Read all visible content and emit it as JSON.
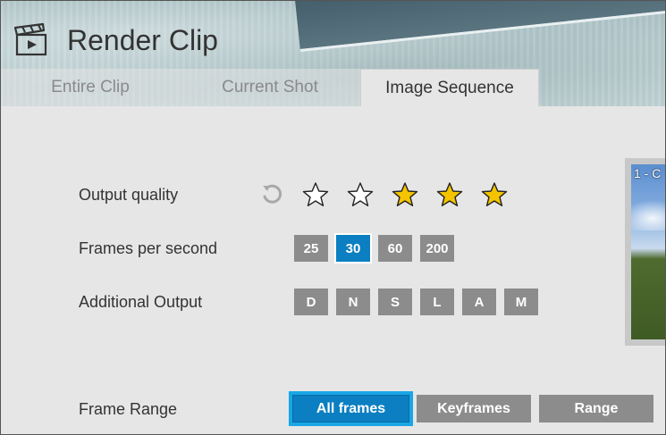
{
  "window": {
    "title": "Render Clip"
  },
  "tabs": [
    {
      "label": "Entire Clip",
      "active": false
    },
    {
      "label": "Current Shot",
      "active": false
    },
    {
      "label": "Image Sequence",
      "active": true
    }
  ],
  "output_quality": {
    "label": "Output quality",
    "reset_icon": "reset-icon",
    "stars_total": 5,
    "stars_filled": 3,
    "filled_color": "#f5c400",
    "empty_color": "#ffffff"
  },
  "fps": {
    "label": "Frames per second",
    "options": [
      "25",
      "30",
      "60",
      "200"
    ],
    "selected": "30"
  },
  "additional_output": {
    "label": "Additional Output",
    "options": [
      "D",
      "N",
      "S",
      "L",
      "A",
      "M"
    ]
  },
  "frame_range": {
    "label": "Frame Range",
    "options": [
      "All frames",
      "Keyframes",
      "Range"
    ],
    "selected": "All frames"
  },
  "preview": {
    "label": "1 - C"
  },
  "colors": {
    "accent": "#0b7fc1",
    "focus_ring": "#18a7e6",
    "button_gray": "#8c8c8c"
  }
}
